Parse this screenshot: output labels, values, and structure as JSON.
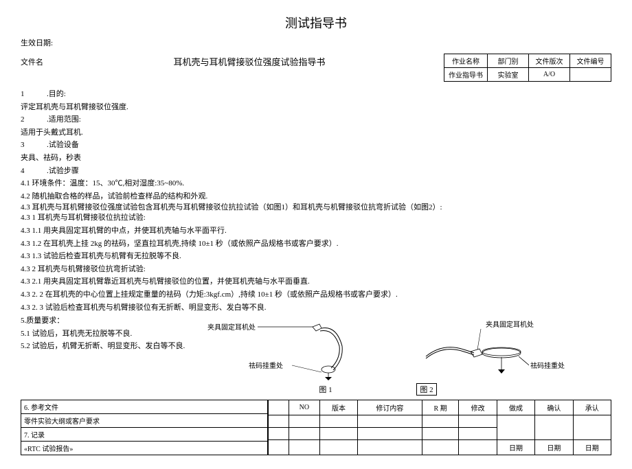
{
  "title": "测试指导书",
  "date_label": "生效日期:",
  "file_label": "文件名",
  "file_name": "耳机壳与耳机臂接驳位强度试验指导书",
  "meta": {
    "h1": "作业名称",
    "h2": "部门别",
    "h3": "文件版次",
    "h4": "文件编号",
    "v1": "作业指导书",
    "v2": "实验室",
    "v3": "A/O",
    "v4": ""
  },
  "lines": {
    "l1a": "1",
    "l1b": ".目的:",
    "l2": "评定耳机壳与耳机臂接驳位强度.",
    "l3a": "2",
    "l3b": ".适用范围:",
    "l4": "适用于头戴式耳机.",
    "l5a": "3",
    "l5b": ".试验设备",
    "l6": "夹具、祛码，秒表",
    "l7a": "4",
    "l7b": ".试验步骤",
    "l8": "4.1 环境条件：温度：15、30℃,相对湿度:35~80%.",
    "l9": "4.2 随机抽取合格的样品，试验前检查样品的结构和外观.",
    "l10": "4.3 耳机壳与耳机臂接驳位强度试验包含耳机壳与耳机臂接驳位抗拉试验（如图1）和耳机壳与机臂接驳位抗弯折试验（如图2）:",
    "l10b": "4.3  1 耳机壳与耳机臂接驳位抗拉试验:",
    "l11": "4.3  1.1 用夹具固定耳机臂的中点，并使耳机壳轴与水平面平行.",
    "l12": "4.3  1.2 在耳机壳上挂 2kg 的祛码，坚直拉耳机壳,持续 10±1 秒（或依照产品规格书或客户要求）.",
    "l13": "4.3  1.3 试验后检查耳机壳与机臂有无拉脱等不良.",
    "l14": "4.3  2 耳机壳与机臂接驳位抗弯折试验:",
    "l15": "4.3  2.1 用夹具固定耳机臂靠近耳机壳与机臂接驳位的位置，并使耳机壳轴与水平面垂直.",
    "l16": "4.3  2. 2 在耳机壳的中心位置上挂规定重量的祛码（力矩:3kgf.cm）,持续 10±1 秒（或依照产品规格书或客户要求）.",
    "l17": "4.3  2. 3 试验后检查耳机壳与机臂接驳位有无折断、明显变形、发白等不良.",
    "l18": "5.质量要求：",
    "l19": "5.1 试验后，耳机壳无拉脱等不良.",
    "l20": "5.2 试验后，机臂无折断、明显变形、发白等不良."
  },
  "diagram1": {
    "clamp": "夹具固定耳机处",
    "weight": "祛码挂重处"
  },
  "diagram2": {
    "clamp": "夹具固定耳机处",
    "weight": "祛码挂重处"
  },
  "fig1": "图 1",
  "fig2": "图 2",
  "bottom_left": {
    "r1": "6. 参考文件",
    "r2": "零件实验大纲或客户要求",
    "r3": "7. 记录",
    "r4": "«RTC 试验报告»"
  },
  "bottom_right": {
    "h1": "NO",
    "h2": "版本",
    "h3": "修订内容",
    "h4": "R 期",
    "h5": "修改",
    "h6": "做成",
    "h7": "确认",
    "h8": "承认",
    "date": "日期"
  }
}
